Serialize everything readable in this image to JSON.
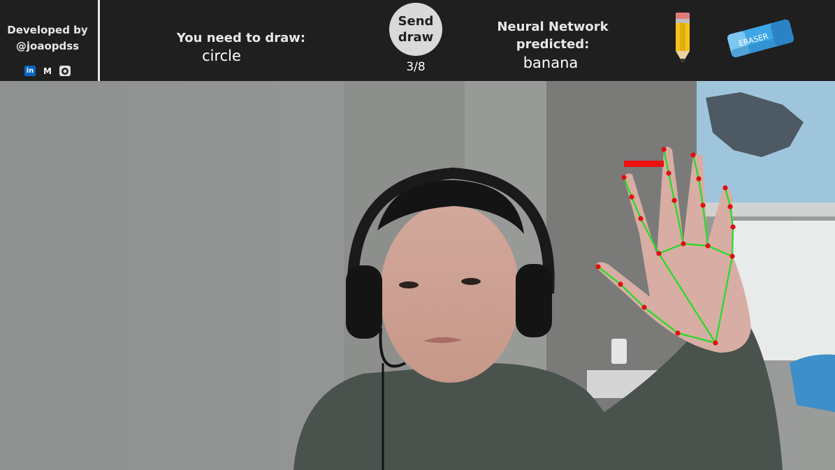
{
  "header": {
    "developer_line1": "Developed by",
    "developer_line2": "@joaopdss",
    "social_icons": [
      "linkedin-icon",
      "medium-icon",
      "github-icon"
    ],
    "social_labels": {
      "linkedin": "in",
      "medium": "M"
    },
    "prompt_label": "You need to draw:",
    "prompt_value": "circle",
    "send_label_line1": "Send",
    "send_label_line2": "draw",
    "counter": "3/8",
    "prediction_label_line1": "Neural Network",
    "prediction_label_line2": "predicted:",
    "prediction_value": "banana",
    "eraser_label": "ERASER"
  },
  "colors": {
    "topbar": "#1f1f1f",
    "landmark_line": "#22dd22",
    "landmark_point": "#dd1111",
    "stroke": "#ee1111"
  }
}
